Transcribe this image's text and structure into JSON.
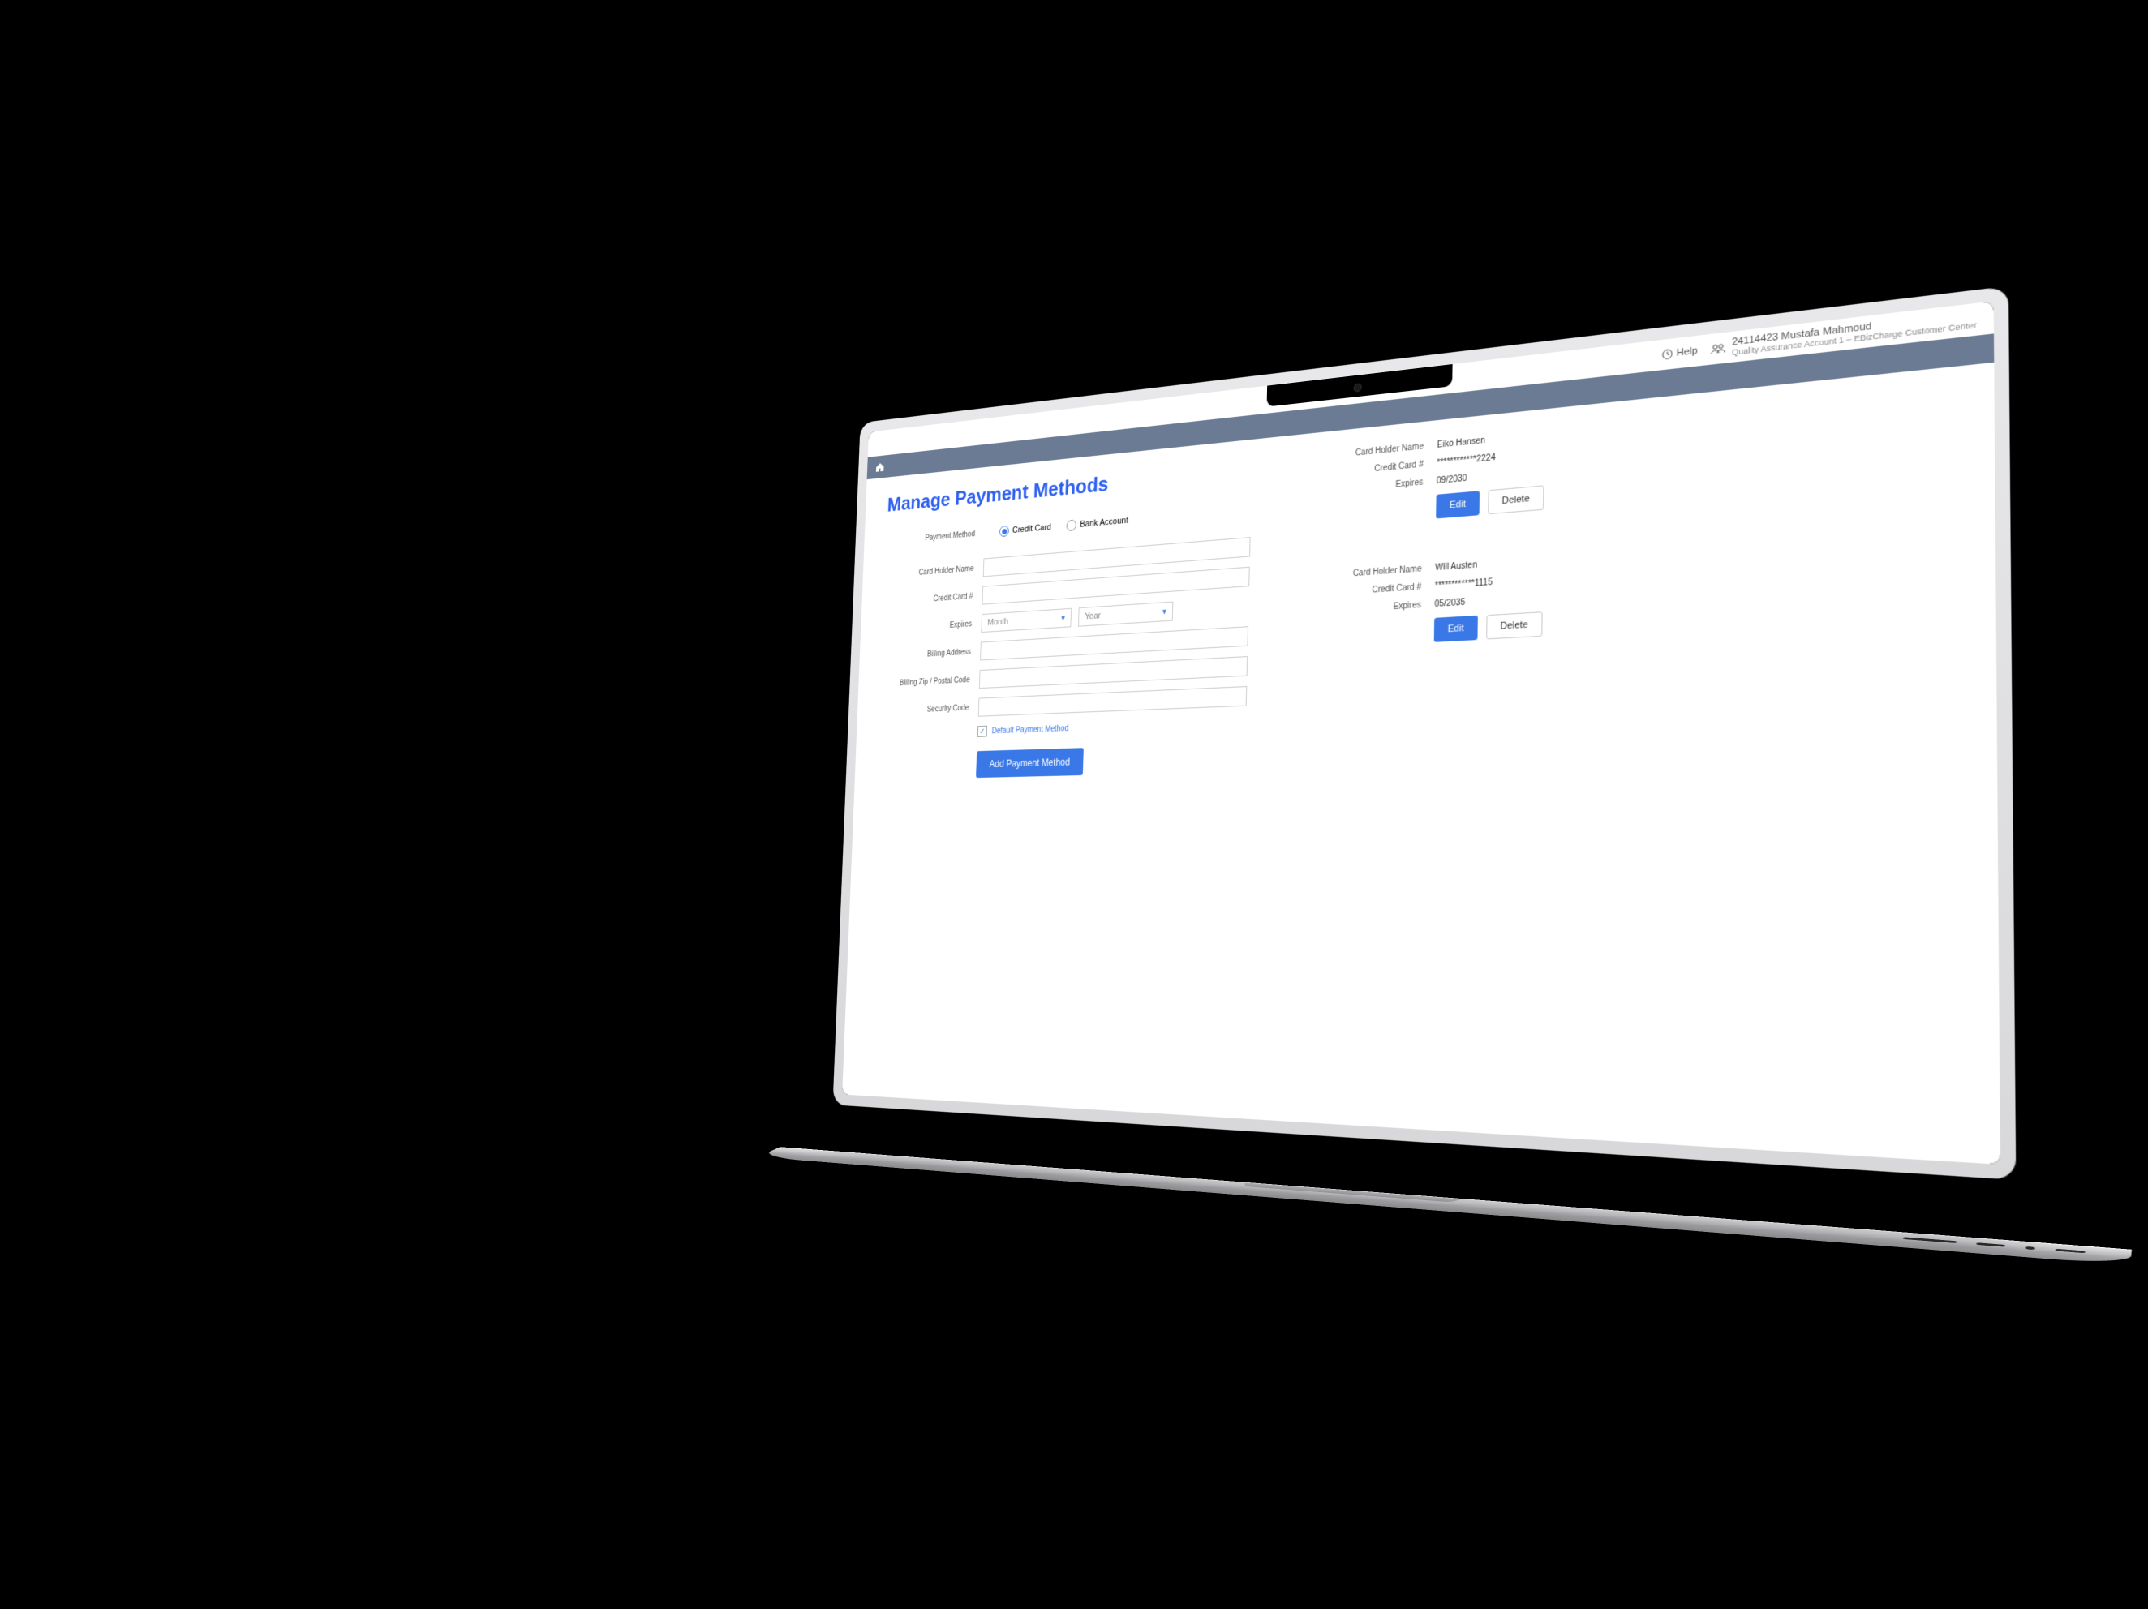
{
  "topbar": {
    "help_label": "Help",
    "account_line1": "24114423 Mustafa Mahmoud",
    "account_line2": "Quality Assurance Account 1 – EBizCharge Customer Center"
  },
  "page": {
    "title": "Manage Payment Methods"
  },
  "form": {
    "payment_method_label": "Payment Method",
    "radio_credit": "Credit Card",
    "radio_bank": "Bank Account",
    "card_holder_label": "Card Holder Name",
    "card_number_label": "Credit Card #",
    "expires_label": "Expires",
    "month_placeholder": "Month",
    "year_placeholder": "Year",
    "billing_address_label": "Billing Address",
    "billing_zip_label": "Billing Zip / Postal Code",
    "security_code_label": "Security Code",
    "default_label": "Default Payment Method",
    "submit_label": "Add Payment Method"
  },
  "cards": [
    {
      "holder_label": "Card Holder Name",
      "holder": "Eiko Hansen",
      "num_label": "Credit Card #",
      "num": "************2224",
      "exp_label": "Expires",
      "exp": "09/2030",
      "edit": "Edit",
      "delete": "Delete"
    },
    {
      "holder_label": "Card Holder Name",
      "holder": "Will Austen",
      "num_label": "Credit Card #",
      "num": "************1115",
      "exp_label": "Expires",
      "exp": "05/2035",
      "edit": "Edit",
      "delete": "Delete"
    }
  ]
}
